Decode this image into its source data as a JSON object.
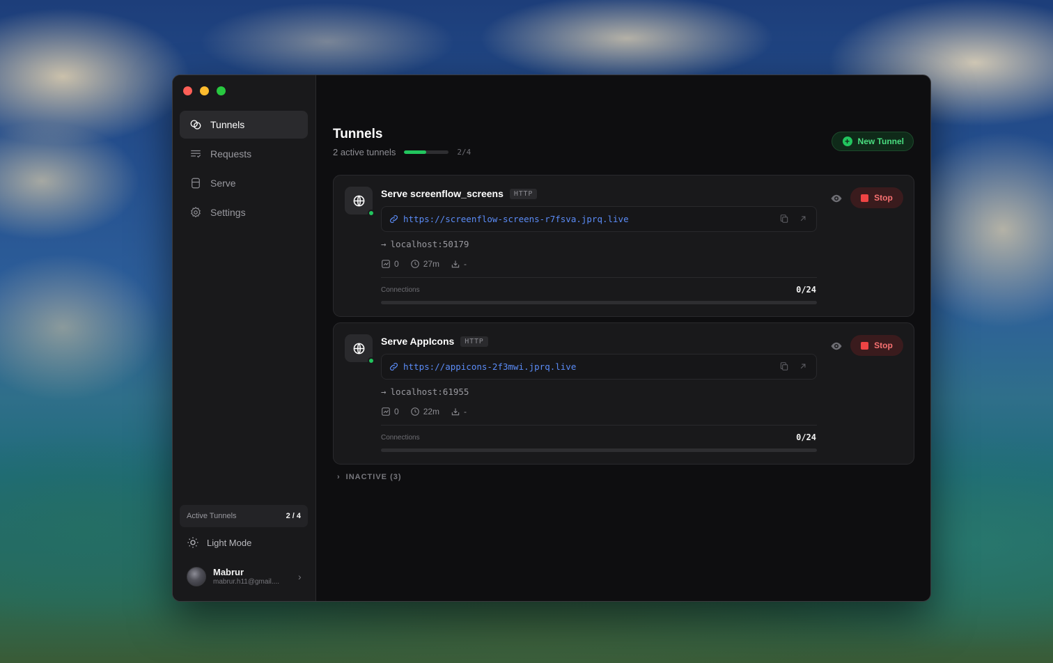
{
  "sidebar": {
    "nav": [
      {
        "label": "Tunnels",
        "icon": "tunnels-icon",
        "active": true
      },
      {
        "label": "Requests",
        "icon": "requests-icon",
        "active": false
      },
      {
        "label": "Serve",
        "icon": "serve-icon",
        "active": false
      },
      {
        "label": "Settings",
        "icon": "gear-icon",
        "active": false
      }
    ],
    "active_tunnels_label": "Active Tunnels",
    "active_tunnels_count": "2 / 4",
    "light_mode_label": "Light Mode",
    "user": {
      "name": "Mabrur",
      "email": "mabrur.h11@gmail...."
    }
  },
  "header": {
    "title": "Tunnels",
    "subtitle": "2 active tunnels",
    "progress_fraction": 0.5,
    "progress_text": "2/4",
    "new_tunnel_label": "New Tunnel"
  },
  "tunnels": [
    {
      "name": "Serve screenflow_screens",
      "protocol": "HTTP",
      "url": "https://screenflow-screens-r7fsva.jprq.live",
      "target_arrow": "→",
      "target": "localhost:50179",
      "requests": "0",
      "uptime": "27m",
      "bandwidth": "-",
      "connections_label": "Connections",
      "connections": "0/24",
      "connections_fraction": 0,
      "stop_label": "Stop",
      "status": "online"
    },
    {
      "name": "Serve AppIcons",
      "protocol": "HTTP",
      "url": "https://appicons-2f3mwi.jprq.live",
      "target_arrow": "→",
      "target": "localhost:61955",
      "requests": "0",
      "uptime": "22m",
      "bandwidth": "-",
      "connections_label": "Connections",
      "connections": "0/24",
      "connections_fraction": 0,
      "stop_label": "Stop",
      "status": "online"
    }
  ],
  "inactive_label": "INACTIVE (3)",
  "colors": {
    "accent_green": "#22c55e",
    "link_blue": "#5b8cf7",
    "stop_red": "#ef4444",
    "window_bg": "#0e0e10",
    "sidebar_bg": "#19191b"
  }
}
